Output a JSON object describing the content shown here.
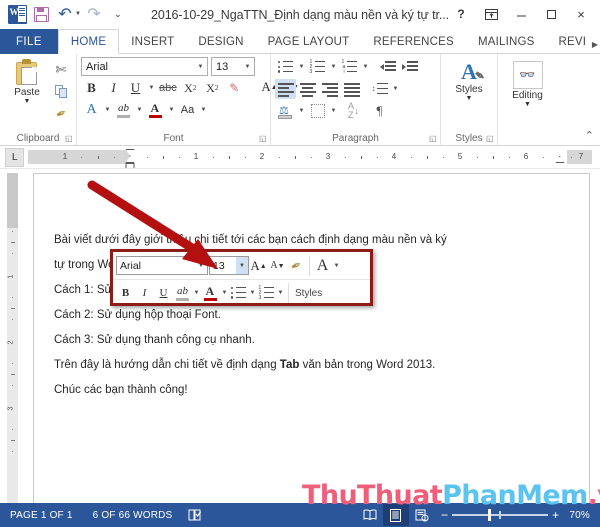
{
  "titlebar": {
    "document_title": "2016-10-29_NgaTTN_Định dạng màu nền và ký tự tr...",
    "qat": {
      "app_icon": "word-icon",
      "save": "save-icon",
      "undo": "undo-icon",
      "redo": "redo-icon",
      "customize": "customize-quick-access-icon",
      "customize_glyph": "⌄"
    },
    "window_controls": {
      "help": "?",
      "ribbon_display_options": "ribbon-display-options-icon",
      "minimize": "minimize-icon",
      "maximize": "maximize-icon",
      "close": "×"
    }
  },
  "tabs": [
    {
      "label": "FILE",
      "type": "file"
    },
    {
      "label": "HOME",
      "active": true
    },
    {
      "label": "INSERT"
    },
    {
      "label": "DESIGN"
    },
    {
      "label": "PAGE LAYOUT"
    },
    {
      "label": "REFERENCES"
    },
    {
      "label": "MAILINGS"
    },
    {
      "label": "REVI"
    }
  ],
  "ribbon": {
    "collapse_glyph": "⌃",
    "groups": {
      "clipboard": {
        "label": "Clipboard",
        "paste_label": "Paste",
        "paste_caret": "▼",
        "cut_icon": "scissors-icon",
        "copy_icon": "copy-icon",
        "format_painter_icon": "format-painter-icon",
        "dialog_launcher": "◱"
      },
      "font": {
        "label": "Font",
        "font_name": "Arial",
        "font_size": "13",
        "bold": "B",
        "italic": "I",
        "underline": "U",
        "strikethrough": "abc",
        "subscript": "X",
        "subscript_n": "2",
        "superscript": "X",
        "superscript_n": "2",
        "clear_formatting_icon": "clear-formatting-icon",
        "text_effects": "A",
        "highlight": "ab",
        "font_color": "A",
        "change_case": "Aa",
        "grow_font": "A",
        "shrink_font": "A",
        "dialog_launcher": "◱"
      },
      "paragraph": {
        "label": "Paragraph",
        "bullets_icon": "bullets-icon",
        "numbering_icon": "numbering-icon",
        "multilevel_icon": "multilevel-list-icon",
        "decrease_indent_icon": "decrease-indent-icon",
        "increase_indent_icon": "increase-indent-icon",
        "align_left_icon": "align-left-icon",
        "align_center_icon": "align-center-icon",
        "align_right_icon": "align-right-icon",
        "justify_icon": "justify-icon",
        "line_spacing_icon": "line-spacing-icon",
        "shading_icon": "shading-icon",
        "borders_icon": "borders-icon",
        "sort_icon": "sort-icon",
        "show_marks": "¶",
        "dialog_launcher": "◱"
      },
      "styles": {
        "label": "Styles",
        "button_label": "Styles",
        "caret": "▼",
        "dialog_launcher": "◱"
      },
      "editing": {
        "label": "",
        "button_label": "Editing",
        "icon": "binoculars-icon",
        "caret": "▼"
      }
    }
  },
  "ruler": {
    "tab_stop_glyph": "L",
    "horizontal_numbers": [
      "1",
      "1",
      "2",
      "3",
      "4",
      "5",
      "6",
      "7"
    ],
    "vertical_numbers": [
      "1",
      "2",
      "3"
    ]
  },
  "document": {
    "lines": [
      {
        "text": "Bài viết dưới đây giới thiệu chi tiết tới các bạn cách định dạng màu nền và ký"
      },
      {
        "text": "tự trong Word 2013."
      },
      {
        "text": "Cách 1: Sử dụng thanh công cụ Ribbon."
      },
      {
        "text": "Cách 2: Sử dụng hộp thoại Font."
      },
      {
        "text": "Cách 3: Sử dụng thanh công cụ nhanh.",
        "selected_prefix": "Cách"
      },
      {
        "text": "Trên đây là hướng dẫn chi tiết về định dạng ",
        "bold": "Tab",
        "text_after": " văn bản trong Word 2013."
      },
      {
        "text": "Chúc các bạn thành công!"
      }
    ]
  },
  "mini_toolbar": {
    "border_color": "#8e1b17",
    "font_name": "Arial",
    "font_size": "13",
    "grow_font": "A",
    "shrink_font": "A",
    "format_painter_icon": "format-painter-icon",
    "text_effects": "A",
    "bold": "B",
    "italic": "I",
    "underline": "U",
    "highlight": "ab",
    "font_color": "A",
    "bullets_icon": "bullets-icon",
    "numbering_icon": "numbering-icon",
    "styles_label": "Styles"
  },
  "annotation": {
    "arrow_color": "#b3100f",
    "arrow_name": "red-pointer-arrow"
  },
  "watermark": {
    "part1": "ThuThuat",
    "part2": "PhanMem",
    "part3": ".vn",
    "color1": "#ef5f7a",
    "color2": "#5bc3ef"
  },
  "statusbar": {
    "page": "PAGE 1 OF 1",
    "words": "6 OF 66 WORDS",
    "proofing_icon": "proofing-errors-icon",
    "read_mode_icon": "read-mode-icon",
    "print_layout_icon": "print-layout-icon",
    "web_layout_icon": "web-layout-icon",
    "zoom_out": "−",
    "zoom_in": "+",
    "zoom_level": "70%",
    "accent": "#2b579a"
  }
}
